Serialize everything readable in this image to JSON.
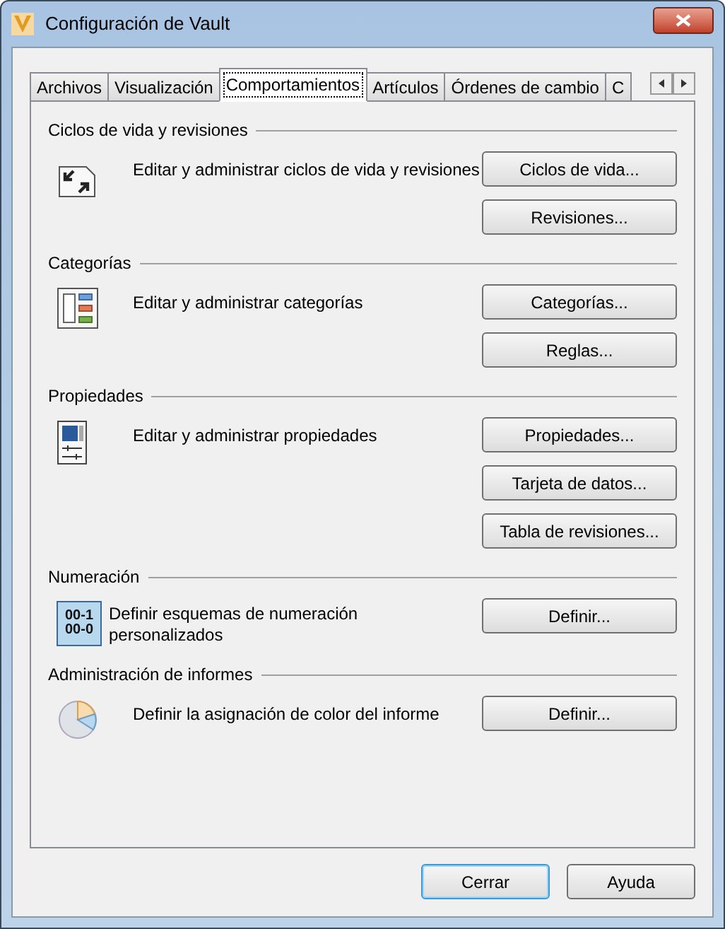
{
  "window": {
    "title": "Configuración de Vault"
  },
  "tabs": [
    {
      "label": "Archivos",
      "selected": false
    },
    {
      "label": "Visualización",
      "selected": false
    },
    {
      "label": "Comportamientos",
      "selected": true
    },
    {
      "label": "Artículos",
      "selected": false
    },
    {
      "label": "Órdenes de cambio",
      "selected": false
    },
    {
      "label": "C",
      "selected": false
    }
  ],
  "sections": [
    {
      "title": "Ciclos de vida y revisiones",
      "kind": "lifecycle",
      "description": "Editar y administrar ciclos de vida y revisiones",
      "buttons": [
        "Ciclos de vida...",
        "Revisiones..."
      ]
    },
    {
      "title": "Categorías",
      "kind": "categories",
      "description": "Editar y administrar categorías",
      "buttons": [
        "Categorías...",
        "Reglas..."
      ]
    },
    {
      "title": "Propiedades",
      "kind": "properties",
      "description": "Editar y administrar propiedades",
      "buttons": [
        "Propiedades...",
        "Tarjeta de datos...",
        "Tabla de revisiones..."
      ]
    },
    {
      "title": "Numeración",
      "kind": "numbering",
      "icon_text": [
        "00-1",
        "00-0"
      ],
      "description": "Definir esquemas de numeración personalizados",
      "buttons": [
        "Definir..."
      ]
    },
    {
      "title": "Administración de informes",
      "kind": "reports",
      "description": "Definir la asignación de color del informe",
      "buttons": [
        "Definir..."
      ]
    }
  ],
  "footer_buttons": [
    {
      "label": "Cerrar",
      "default": true
    },
    {
      "label": "Ayuda",
      "default": false
    }
  ]
}
